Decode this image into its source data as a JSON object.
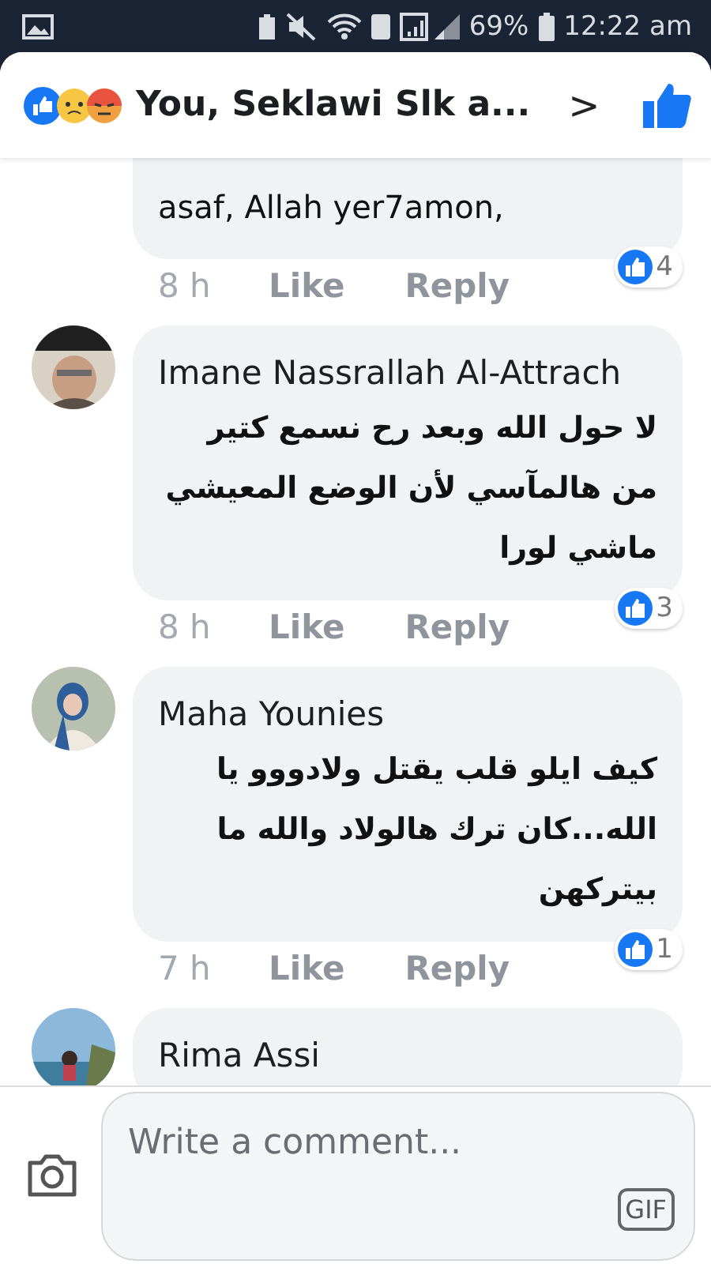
{
  "status_bar": {
    "battery": "69%",
    "time": "12:22 am"
  },
  "header": {
    "reactors": "You, Seklawi Slk a...",
    "chevron": ">"
  },
  "comments": [
    {
      "text": "asaf, Allah yer7amon,",
      "time": "8 h",
      "like": "Like",
      "reply": "Reply",
      "reactions": "4"
    },
    {
      "name": "Imane Nassrallah Al-Attrach",
      "text": "لا حول الله وبعد رح نسمع كتير من هالمآسي لأن الوضع  المعيشي ماشي لورا",
      "time": "8 h",
      "like": "Like",
      "reply": "Reply",
      "reactions": "3"
    },
    {
      "name": "Maha Younies",
      "text": "كيف ايلو قلب يقتل ولادووو يا الله...كان ترك هالولاد والله ما بيتركهن",
      "time": "7 h",
      "like": "Like",
      "reply": "Reply",
      "reactions": "1"
    },
    {
      "name": "Rima Assi"
    }
  ],
  "composer": {
    "placeholder": "Write a comment...",
    "gif": "GIF"
  }
}
